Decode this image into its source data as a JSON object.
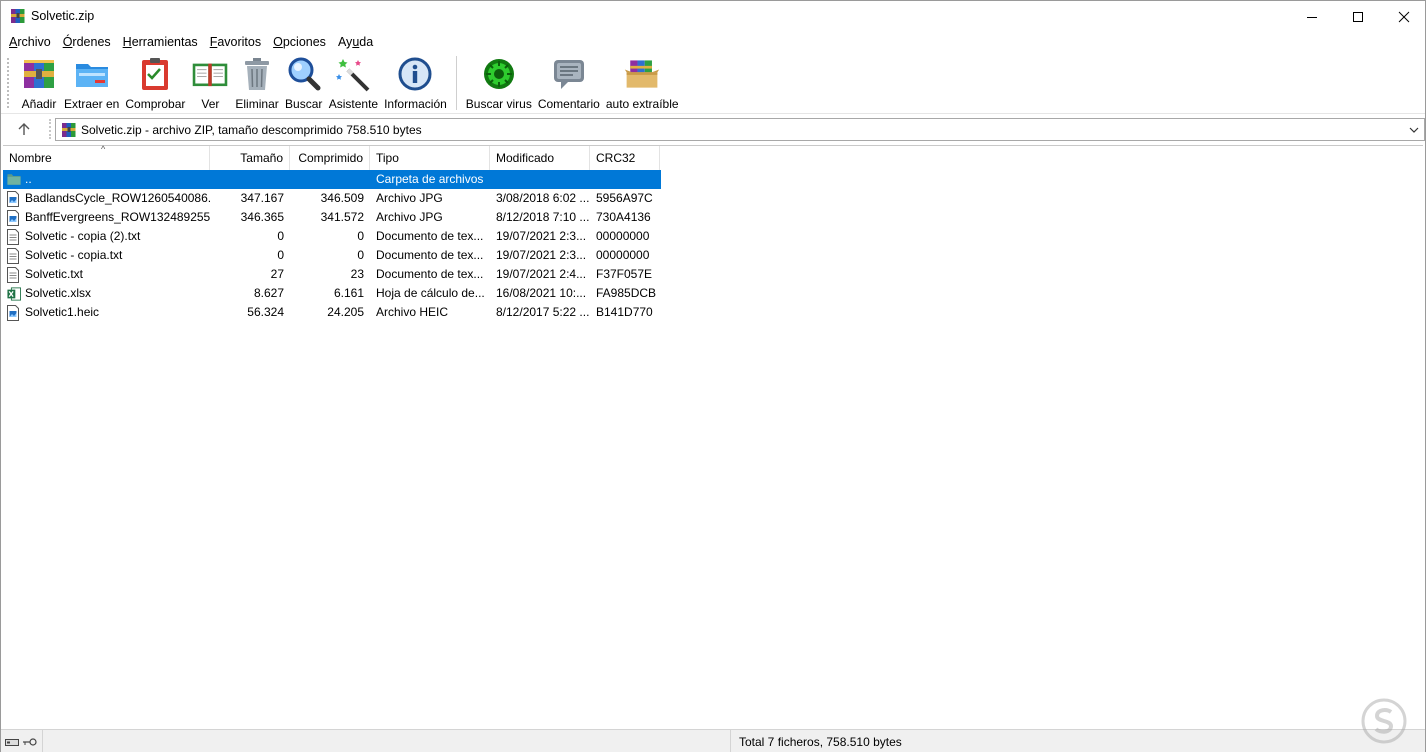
{
  "window": {
    "title": "Solvetic.zip"
  },
  "menu": [
    {
      "label": "Archivo",
      "key": "A",
      "rest": "rchivo"
    },
    {
      "label": "Órdenes",
      "key": "Ó",
      "rest": "rdenes"
    },
    {
      "label": "Herramientas",
      "key": "H",
      "rest": "erramientas"
    },
    {
      "label": "Favoritos",
      "key": "F",
      "rest": "avoritos"
    },
    {
      "label": "Opciones",
      "key": "O",
      "rest": "pciones"
    },
    {
      "label": "Ayuda",
      "pre": "Ay",
      "key": "u",
      "rest": "da"
    }
  ],
  "toolbar": {
    "add": "Añadir",
    "extract": "Extraer en",
    "test": "Comprobar",
    "view": "Ver",
    "delete": "Eliminar",
    "find": "Buscar",
    "wizard": "Asistente",
    "info": "Información",
    "virus": "Buscar virus",
    "comment": "Comentario",
    "sfx": "auto extraíble"
  },
  "address": {
    "text": "Solvetic.zip - archivo ZIP, tamaño descomprimido 758.510 bytes"
  },
  "columns": {
    "name": "Nombre",
    "size": "Tamaño",
    "packed": "Comprimido",
    "type": "Tipo",
    "modified": "Modificado",
    "crc": "CRC32"
  },
  "rows": [
    {
      "icon": "folder-icon",
      "name": "..",
      "size": "",
      "packed": "",
      "type": "Carpeta de archivos",
      "modified": "",
      "crc": "",
      "selected": true
    },
    {
      "icon": "image-file-icon",
      "name": "BadlandsCycle_ROW1260540086...",
      "size": "347.167",
      "packed": "346.509",
      "type": "Archivo JPG",
      "modified": "3/08/2018 6:02 ...",
      "crc": "5956A97C"
    },
    {
      "icon": "image-file-icon",
      "name": "BanffEvergreens_ROW132489255...",
      "size": "346.365",
      "packed": "341.572",
      "type": "Archivo JPG",
      "modified": "8/12/2018 7:10 ...",
      "crc": "730A4136"
    },
    {
      "icon": "text-file-icon",
      "name": "Solvetic - copia (2).txt",
      "size": "0",
      "packed": "0",
      "type": "Documento de tex...",
      "modified": "19/07/2021 2:3...",
      "crc": "00000000"
    },
    {
      "icon": "text-file-icon",
      "name": "Solvetic - copia.txt",
      "size": "0",
      "packed": "0",
      "type": "Documento de tex...",
      "modified": "19/07/2021 2:3...",
      "crc": "00000000"
    },
    {
      "icon": "text-file-icon",
      "name": "Solvetic.txt",
      "size": "27",
      "packed": "23",
      "type": "Documento de tex...",
      "modified": "19/07/2021 2:4...",
      "crc": "F37F057E"
    },
    {
      "icon": "excel-file-icon",
      "name": "Solvetic.xlsx",
      "size": "8.627",
      "packed": "6.161",
      "type": "Hoja de cálculo de...",
      "modified": "16/08/2021 10:...",
      "crc": "FA985DCB"
    },
    {
      "icon": "image-file-icon",
      "name": "Solvetic1.heic",
      "size": "56.324",
      "packed": "24.205",
      "type": "Archivo HEIC",
      "modified": "8/12/2017 5:22 ...",
      "crc": "B141D770"
    }
  ],
  "status": {
    "text": "Total 7 ficheros, 758.510 bytes"
  },
  "colors": {
    "selection": "#0078d7",
    "statusbar": "#f0f0f0"
  }
}
